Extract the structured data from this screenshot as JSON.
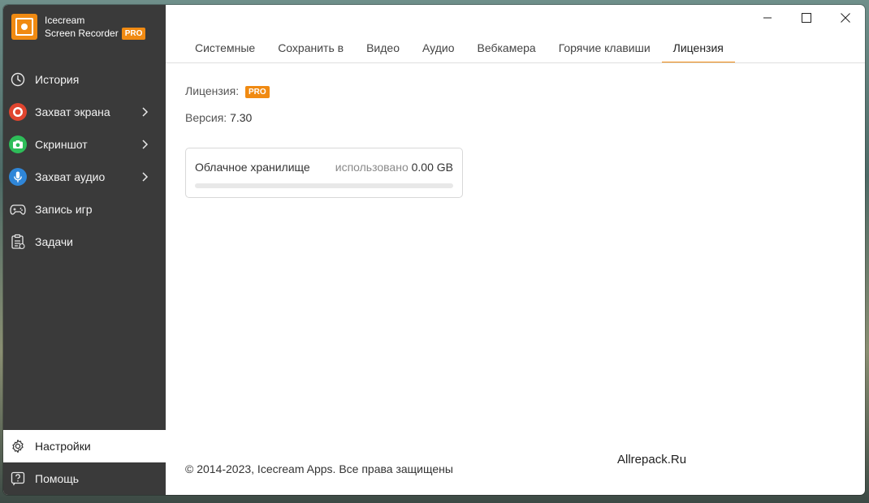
{
  "app": {
    "name_line1": "Icecream",
    "name_line2": "Screen Recorder",
    "badge": "PRO",
    "accent": "#f08a12"
  },
  "sidebar": {
    "items": [
      {
        "label": "История",
        "icon": "history-clock-icon"
      },
      {
        "label": "Захват экрана",
        "icon": "record-icon",
        "color": "#e0452f"
      },
      {
        "label": "Скриншот",
        "icon": "camera-icon",
        "color": "#2ebd59"
      },
      {
        "label": "Захват аудио",
        "icon": "microphone-icon",
        "color": "#2f86d8"
      },
      {
        "label": "Запись игр",
        "icon": "gamepad-icon"
      },
      {
        "label": "Задачи",
        "icon": "tasks-clipboard-icon"
      }
    ],
    "bottom": [
      {
        "label": "Настройки",
        "icon": "gear-icon",
        "active": true
      },
      {
        "label": "Помощь",
        "icon": "help-icon"
      }
    ]
  },
  "tabs": [
    {
      "label": "Системные"
    },
    {
      "label": "Сохранить в"
    },
    {
      "label": "Видео"
    },
    {
      "label": "Аудио"
    },
    {
      "label": "Вебкамера"
    },
    {
      "label": "Горячие клавиши"
    },
    {
      "label": "Лицензия",
      "active": true
    }
  ],
  "license": {
    "license_label": "Лицензия:",
    "license_badge": "PRO",
    "version_label": "Версия:",
    "version_value": "7.30"
  },
  "cloud": {
    "title": "Облачное хранилище",
    "used_label": "использовано",
    "used_value": "0.00 GB",
    "used_fraction": 0
  },
  "footer": {
    "copyright": "© 2014-2023, Icecream Apps. Все права защищены",
    "watermark": "Allrepack.Ru"
  }
}
